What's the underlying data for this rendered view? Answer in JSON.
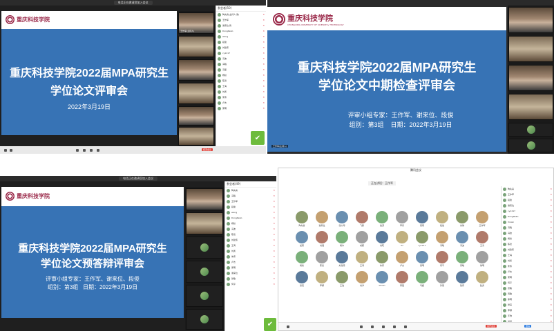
{
  "window_title": "电话正在邀请您加入会议",
  "school": {
    "name_cn": "重庆科技学院",
    "name_en": "CHONGQING UNIVERSITY OF SCIENCE & TECHNOLOGY"
  },
  "panels": [
    {
      "slide_title_1": "重庆科技学院2022届MPA研究生",
      "slide_title_2": "学位论文评审会",
      "date": "2022年3月19日",
      "end_label": "结束会议",
      "participants_header": "参会者(50)",
      "videos": [
        "王作军(主持人)",
        "",
        "",
        "",
        "",
        "",
        ""
      ],
      "list": [
        "陶先喜(主持人,我)",
        "王作军",
        "谢来位 我",
        "DongRebo",
        "wang",
        "段俊",
        "刘建伟",
        "cy1217",
        "冯波",
        "冯曦",
        "冯星",
        "杨秋",
        "陈德",
        "王海",
        "刘勇",
        "朱伟",
        "卢杰",
        "吴明"
      ]
    },
    {
      "slide_title_1": "重庆科技学院2022届MPA研究生",
      "slide_title_2": "学位论文中期检查评审会",
      "experts": "评审小组专家：王作军、谢来位、段俊",
      "group": "组别：第3组",
      "date": "日期：2022年3月19日",
      "speaker_tag": "王作军(主持人)"
    },
    {
      "slide_title_1": "重庆科技学院2022届MPA研究生",
      "slide_title_2": "学位论文预答辩评审会",
      "experts": "评审小组专家：王作军、谢来位、段俊",
      "group": "组别：第3组",
      "date": "日期：2022年3月19日",
      "participants_header": "参会者(49)",
      "list": [
        "陶先喜",
        "冯曦",
        "王作军",
        "段俊",
        "wang",
        "DongRebo",
        "杨秋",
        "冯波",
        "陈德",
        "刘建伟",
        "王海",
        "刘勇",
        "朱伟",
        "卢杰",
        "吴明",
        "谢来位",
        "张敏",
        "何平"
      ]
    },
    {
      "meeting_title": "腾讯会议",
      "speaker": "正在讲话：王作军",
      "gallery": [
        "陶先喜",
        "谢来位",
        "张大海",
        "飞鹏",
        "俊源",
        "李丹",
        "夏雨",
        "段俊",
        "刘静",
        "王作军",
        "加荣",
        "刘湘",
        "杨冰",
        "成都",
        "刘晓",
        "57",
        "cy1217",
        "冯曦",
        "冯波",
        "王涛",
        "杨秋",
        "陈德",
        "刘建伟",
        "王海",
        "朱伟",
        "卢杰",
        "吴明",
        "何平",
        "周敏",
        "徐明",
        "张亮",
        "李娜",
        "王浩",
        "刘洋",
        "Vivian",
        "黄强",
        "马超",
        "孙丽",
        "钱伟",
        "赵勇"
      ],
      "list": [
        "陶先喜",
        "王作军",
        "段俊",
        "谢来位",
        "cy1217",
        "DongRebo",
        "Vivian",
        "冯曦",
        "冯波",
        "杨秋",
        "陈德",
        "刘建伟",
        "王海",
        "刘勇",
        "朱伟",
        "卢杰",
        "吴明",
        "何平",
        "张敏",
        "周敏",
        "徐明",
        "张亮",
        "李娜",
        "王浩",
        "刘洋"
      ],
      "end_label": "离开会议",
      "invite_label": "邀请"
    }
  ]
}
